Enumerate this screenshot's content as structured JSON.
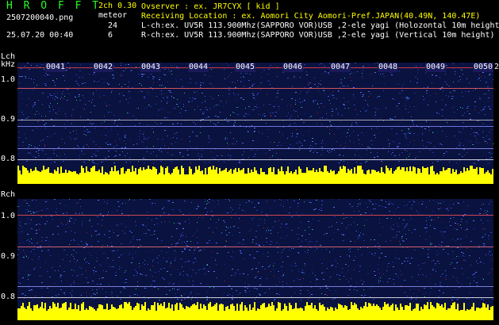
{
  "header": {
    "title": "H R O F F T",
    "mode": "2ch 0.30",
    "meteor_label": "meteor",
    "file": "2507200040.png",
    "timestamp": "25.07.20 00:40",
    "count_l": "24",
    "count_r": "6"
  },
  "info": {
    "observer": "Ovserver              : ex. JR7CYX [ kid ]",
    "location": "Receiving Location : ex. Aomori City Aomori-Pref.JAPAN(40.49N, 140.47E)",
    "lch": "L-ch:ex. UV5R 113.900Mhz(SAPPORO VOR)USB ,2-ele yagi (Holozontal 10m height",
    "rch": "R-ch:ex. UV5R 113.900Mhz(SAPPORO VOR)USB ,2-ele yagi (Vertical 10m height)"
  },
  "lch": {
    "label": "Lch",
    "unit": "kHz",
    "ticks": [
      "1.0",
      "0.9",
      "0.8"
    ]
  },
  "rch": {
    "label": "Rch",
    "ticks": [
      "1.0",
      "0.9",
      "0.8"
    ]
  },
  "time_markers": [
    "0041",
    "0042",
    "0043",
    "0044",
    "0045",
    "0046",
    "0047",
    "0048",
    "0049",
    "0050",
    "2"
  ],
  "colors": {
    "background": "#000000",
    "title": "#22ff22",
    "mode": "#ffff00",
    "text": "#ffffff",
    "spectrum_bg": "#0a1240",
    "amplitude": "#ffff00"
  }
}
